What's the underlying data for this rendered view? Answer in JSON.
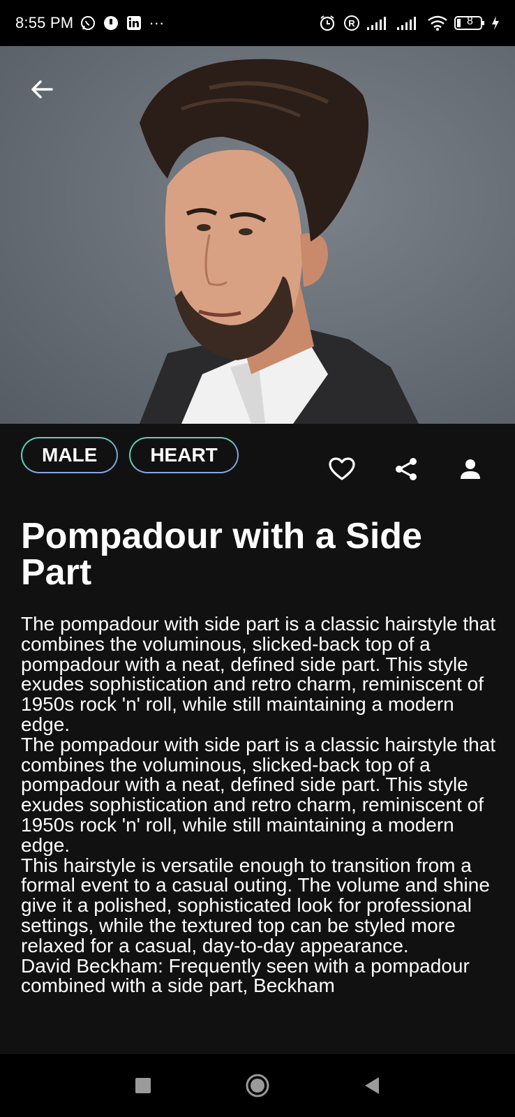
{
  "status_bar": {
    "time": "8:55 PM",
    "more": "···",
    "battery": "8",
    "icons": [
      "whatsapp-icon",
      "app-icon",
      "linkedin-icon",
      "alarm-icon",
      "registered-icon",
      "signal-icon",
      "signal-icon",
      "wifi-icon",
      "battery-icon",
      "charging-icon"
    ]
  },
  "hero": {
    "back_icon": "arrow-left-icon",
    "background": "#6a7179"
  },
  "tags": [
    "MALE",
    "HEART"
  ],
  "actions": {
    "favorite": "heart-icon",
    "share": "share-icon",
    "profile": "person-icon"
  },
  "title": "Pompadour with a Side Part",
  "description": "The pompadour with side part is a classic hairstyle that combines the voluminous, slicked-back top of a pompadour with a neat, defined side part. This style exudes sophistication and retro charm, reminiscent of 1950s rock 'n' roll, while still maintaining a modern edge.\nThe pompadour with side part is a classic hairstyle that combines the voluminous, slicked-back top of a pompadour with a neat, defined side part. This style exudes sophistication and retro charm, reminiscent of 1950s rock 'n' roll, while still maintaining a modern edge.\nThis hairstyle is versatile enough to transition from a formal event to a casual outing. The volume and shine give it a polished, sophisticated look for professional settings, while the textured top can be styled more relaxed for a casual, day-to-day appearance.\nDavid Beckham: Frequently seen with a pompadour combined with a side part, Beckham",
  "nav": {
    "recent": "square-icon",
    "home": "circle-icon",
    "back": "triangle-back-icon"
  },
  "colors": {
    "background": "#111111",
    "tag_border": "#5fd0b5",
    "text": "#ffffff"
  }
}
